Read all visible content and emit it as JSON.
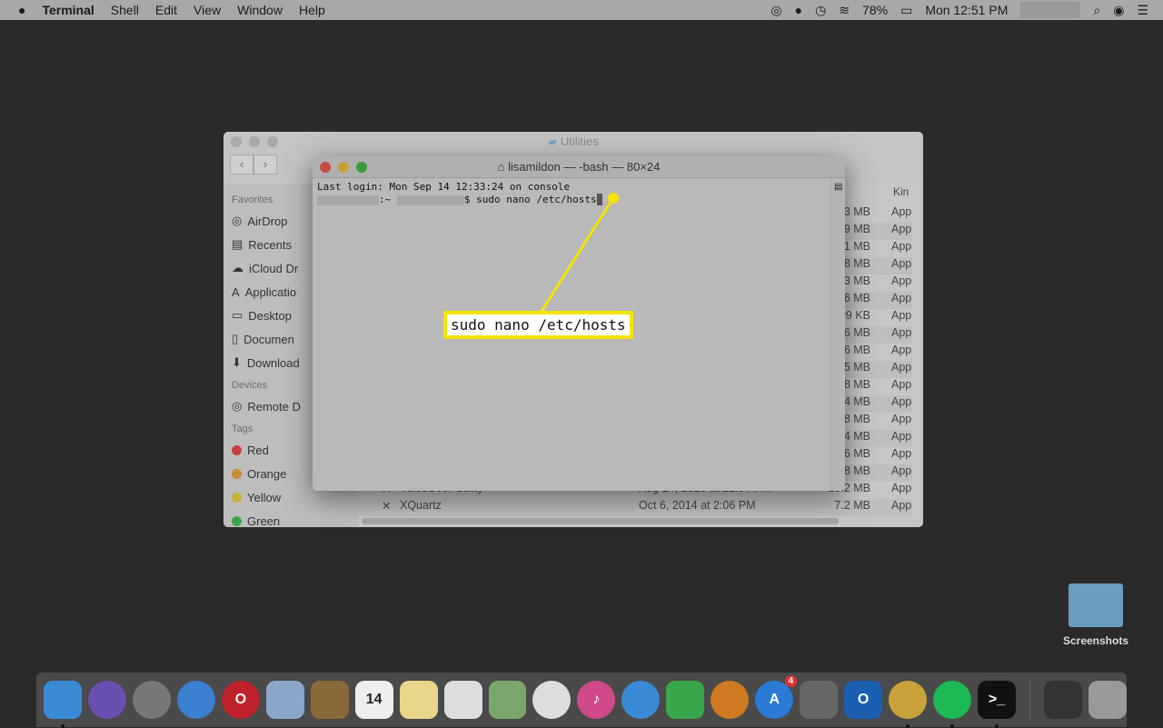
{
  "menubar": {
    "app": "Terminal",
    "items": [
      "Shell",
      "Edit",
      "View",
      "Window",
      "Help"
    ],
    "battery": "78%",
    "clock": "Mon 12:51 PM"
  },
  "finder": {
    "title": "Utilities",
    "sidebar": {
      "favorites_header": "Favorites",
      "favorites": [
        "AirDrop",
        "Recents",
        "iCloud Dr",
        "Applicatio",
        "Desktop",
        "Documen",
        "Download"
      ],
      "devices_header": "Devices",
      "devices": [
        "Remote D"
      ],
      "tags_header": "Tags",
      "tags": [
        {
          "label": "Red",
          "color": "#c94040"
        },
        {
          "label": "Orange",
          "color": "#c98a3a"
        },
        {
          "label": "Yellow",
          "color": "#c9b03a"
        },
        {
          "label": "Green",
          "color": "#3aa64a"
        }
      ]
    },
    "kind_header": "Kin",
    "sizes": [
      "3 MB",
      "9 MB",
      "1 MB",
      "8 MB",
      "3 MB",
      "6 MB",
      "09 KB",
      "6 MB",
      "6 MB",
      "5 MB",
      "8 MB",
      "4 MB",
      "8 MB",
      "4 MB",
      "6 MB",
      "8 MB"
    ],
    "kind": "App",
    "rows": [
      {
        "name": "VoiceOver Utility",
        "date": "Aug 24, 2020 at 12:04 PM",
        "size": "10.2 MB"
      },
      {
        "name": "XQuartz",
        "date": "Oct 6, 2014 at 2:06 PM",
        "size": "7.2 MB"
      }
    ]
  },
  "terminal": {
    "title": "lisamildon — -bash — 80×24",
    "line1": "Last login: Mon Sep 14 12:33:24 on console",
    "prompt_sep": ":~",
    "command": "$ sudo nano /etc/hosts"
  },
  "callout": {
    "text": "sudo nano /etc/hosts",
    "color": "#f5e400"
  },
  "dock": {
    "items": [
      {
        "name": "finder",
        "color": "#3a8ad6"
      },
      {
        "name": "siri",
        "color": "#6a4fb0"
      },
      {
        "name": "launchpad",
        "color": "#777"
      },
      {
        "name": "safari",
        "color": "#3a7fd0"
      },
      {
        "name": "opera",
        "color": "#c0222a",
        "glyph": "O"
      },
      {
        "name": "mail",
        "color": "#8aa6c8"
      },
      {
        "name": "contacts",
        "color": "#8a6a3a"
      },
      {
        "name": "calendar",
        "color": "#eee",
        "glyph": "14"
      },
      {
        "name": "notes",
        "color": "#e8d58a"
      },
      {
        "name": "reminders",
        "color": "#ddd"
      },
      {
        "name": "maps",
        "color": "#7aa66a"
      },
      {
        "name": "photos",
        "color": "#ddd"
      },
      {
        "name": "itunes",
        "color": "#d04a8a",
        "glyph": "♪"
      },
      {
        "name": "messages",
        "color": "#3a8ad6"
      },
      {
        "name": "facetime",
        "color": "#3aa64a"
      },
      {
        "name": "books",
        "color": "#d07a22"
      },
      {
        "name": "app-store",
        "color": "#2a7ad6",
        "glyph": "A",
        "badge": "4"
      },
      {
        "name": "system-preferences",
        "color": "#666"
      },
      {
        "name": "outlook",
        "color": "#1a5fb0",
        "glyph": "O"
      },
      {
        "name": "chrome",
        "color": "#c9a23a"
      },
      {
        "name": "spotify",
        "color": "#1db954"
      },
      {
        "name": "terminal",
        "color": "#111",
        "glyph": ">_"
      }
    ],
    "extra": [
      {
        "name": "archive",
        "color": "#333"
      },
      {
        "name": "trash",
        "color": "#999"
      }
    ]
  },
  "desktop": {
    "folder": "Screenshots"
  }
}
